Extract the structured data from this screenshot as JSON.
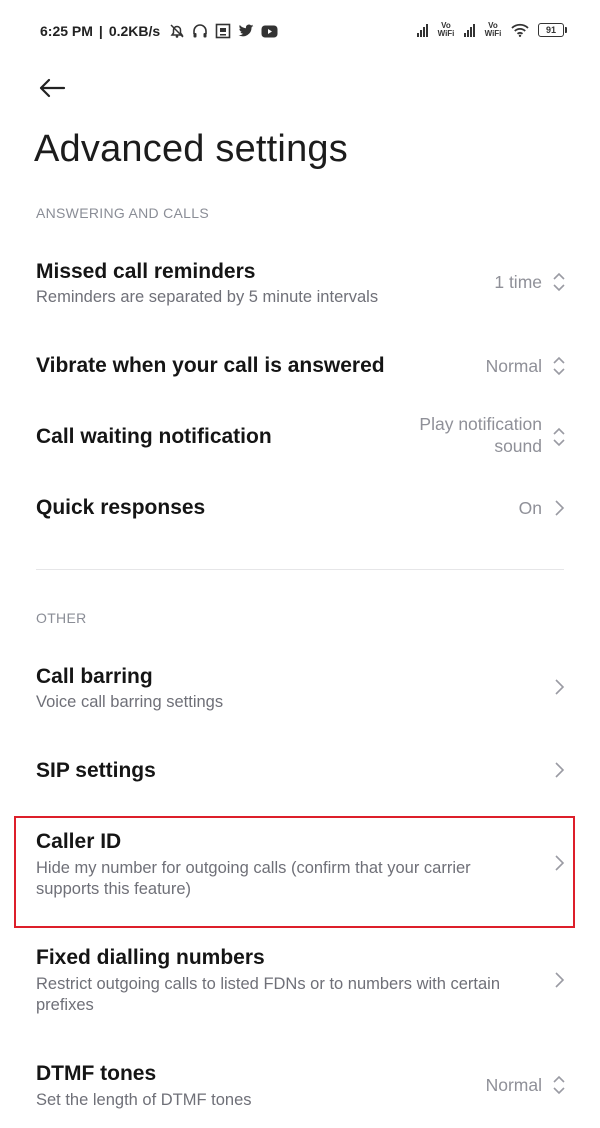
{
  "status_bar": {
    "time": "6:25 PM",
    "separator": "|",
    "speed": "0.2KB/s",
    "vowifi_1": "Vo WiFi",
    "vowifi_2": "Vo WiFi",
    "battery": "91"
  },
  "page": {
    "title": "Advanced settings"
  },
  "sections": {
    "answering": {
      "header": "ANSWERING AND CALLS",
      "missed_call": {
        "title": "Missed call reminders",
        "subtitle": "Reminders are separated by 5 minute intervals",
        "value": "1 time"
      },
      "vibrate": {
        "title": "Vibrate when your call is answered",
        "value": "Normal"
      },
      "call_waiting": {
        "title": "Call waiting notification",
        "value": "Play notification sound"
      },
      "quick_responses": {
        "title": "Quick responses",
        "value": "On"
      }
    },
    "other": {
      "header": "OTHER",
      "call_barring": {
        "title": "Call barring",
        "subtitle": "Voice call barring settings"
      },
      "sip": {
        "title": "SIP settings"
      },
      "caller_id": {
        "title": "Caller ID",
        "subtitle": "Hide my number for outgoing calls (confirm that your carrier supports this feature)"
      },
      "fdn": {
        "title": "Fixed dialling numbers",
        "subtitle": "Restrict outgoing calls to listed FDNs or to numbers with certain prefixes"
      },
      "dtmf": {
        "title": "DTMF tones",
        "subtitle": "Set the length of DTMF tones",
        "value": "Normal"
      }
    }
  },
  "colors": {
    "highlight": "#dd1f2a",
    "secondary_text": "#6f7078",
    "value_text": "#8f9098"
  },
  "icons": [
    "back-arrow-icon",
    "updown-chevron-icon",
    "chevron-right-icon",
    "alarm-off-icon",
    "headphones-icon",
    "picture-icon",
    "twitter-icon",
    "youtube-icon",
    "signal-icon",
    "wifi-icon",
    "battery-icon"
  ]
}
